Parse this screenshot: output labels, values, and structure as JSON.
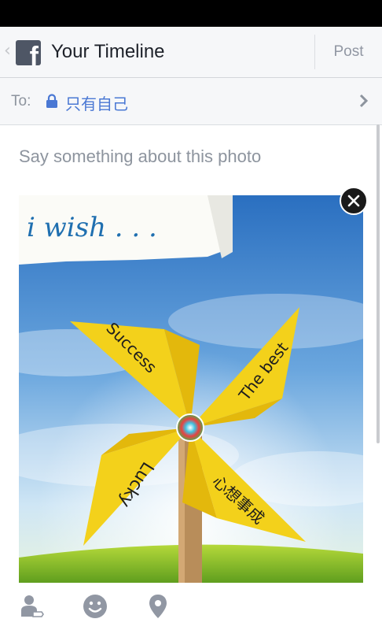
{
  "header": {
    "title": "Your Timeline",
    "post_label": "Post"
  },
  "audience": {
    "to_label": "To:",
    "privacy": "只有自己"
  },
  "composer": {
    "placeholder": "Say something about this photo"
  },
  "photo": {
    "banner_text": "i wish . . .",
    "blade_labels": {
      "top": "Success",
      "right": "The best",
      "bottom": "心想事成",
      "left": "Lucky"
    }
  },
  "icons": {
    "back": "chevron-left-icon",
    "logo": "facebook-logo-icon",
    "privacy": "lock-icon",
    "more": "chevron-right-icon",
    "close": "close-icon",
    "tag": "tag-friends-icon",
    "feeling": "smiley-icon",
    "location": "location-pin-icon"
  },
  "colors": {
    "accent": "#4a78d4",
    "header_bg": "#f6f7f9",
    "blade": "#f3d11b"
  }
}
